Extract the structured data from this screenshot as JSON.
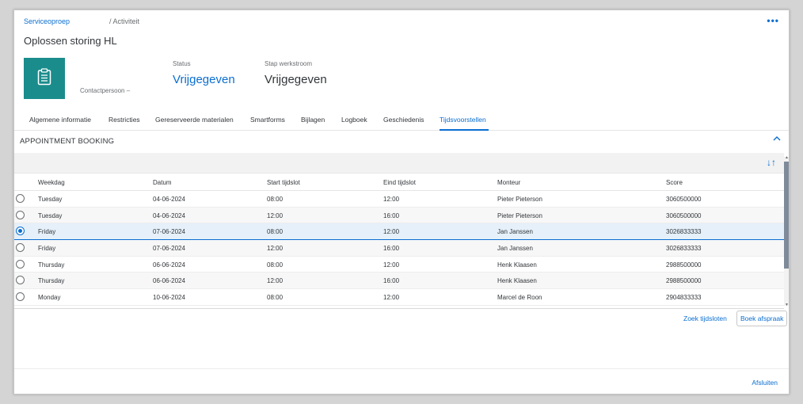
{
  "breadcrumb": {
    "link": "Serviceoproep",
    "current": "/ Activiteit"
  },
  "overflow_label": "•••",
  "title": "Oplossen storing HL",
  "header": {
    "contact_label": "Contactpersoon  –",
    "status": {
      "label": "Status",
      "value": "Vrijgegeven"
    },
    "workflow": {
      "label": "Stap werkstroom",
      "value": "Vrijgegeven"
    }
  },
  "tabs": [
    {
      "label": "Algemene informatie"
    },
    {
      "label": "Restricties"
    },
    {
      "label": "Gereserveerde materialen"
    },
    {
      "label": "Smartforms"
    },
    {
      "label": "Bijlagen"
    },
    {
      "label": "Logboek"
    },
    {
      "label": "Geschiedenis"
    },
    {
      "label": "Tijdsvoorstellen",
      "active": true
    }
  ],
  "section": {
    "title": "APPOINTMENT BOOKING",
    "collapse_icon": "chevron-up-icon"
  },
  "toolbar": {
    "sort_icon": "sort-icon",
    "sort_label": "↓↑"
  },
  "table": {
    "headers": {
      "weekday": "Weekdag",
      "date": "Datum",
      "start": "Start tijdslot",
      "end": "Eind tijdslot",
      "mechanic": "Monteur",
      "score": "Score"
    },
    "rows": [
      {
        "weekday": "Tuesday",
        "date": "04-06-2024",
        "start": "08:00",
        "end": "12:00",
        "mechanic": "Pieter Pieterson",
        "score": "3060500000",
        "selected": false
      },
      {
        "weekday": "Tuesday",
        "date": "04-06-2024",
        "start": "12:00",
        "end": "16:00",
        "mechanic": "Pieter Pieterson",
        "score": "3060500000",
        "selected": false
      },
      {
        "weekday": "Friday",
        "date": "07-06-2024",
        "start": "08:00",
        "end": "12:00",
        "mechanic": "Jan Janssen",
        "score": "3026833333",
        "selected": true
      },
      {
        "weekday": "Friday",
        "date": "07-06-2024",
        "start": "12:00",
        "end": "16:00",
        "mechanic": "Jan Janssen",
        "score": "3026833333",
        "selected": false
      },
      {
        "weekday": "Thursday",
        "date": "06-06-2024",
        "start": "08:00",
        "end": "12:00",
        "mechanic": "Henk Klaasen",
        "score": "2988500000",
        "selected": false
      },
      {
        "weekday": "Thursday",
        "date": "06-06-2024",
        "start": "12:00",
        "end": "16:00",
        "mechanic": "Henk Klaasen",
        "score": "2988500000",
        "selected": false
      },
      {
        "weekday": "Monday",
        "date": "10-06-2024",
        "start": "08:00",
        "end": "12:00",
        "mechanic": "Marcel de Roon",
        "score": "2904833333",
        "selected": false
      }
    ]
  },
  "actions": {
    "search": "Zoek tijdsloten",
    "book": "Boek afspraak"
  },
  "footer": {
    "close": "Afsluiten"
  },
  "colors": {
    "accent": "#0a6ed1",
    "avatar_bg": "#1a8c8c",
    "selected_row": "#e5f0fa"
  }
}
